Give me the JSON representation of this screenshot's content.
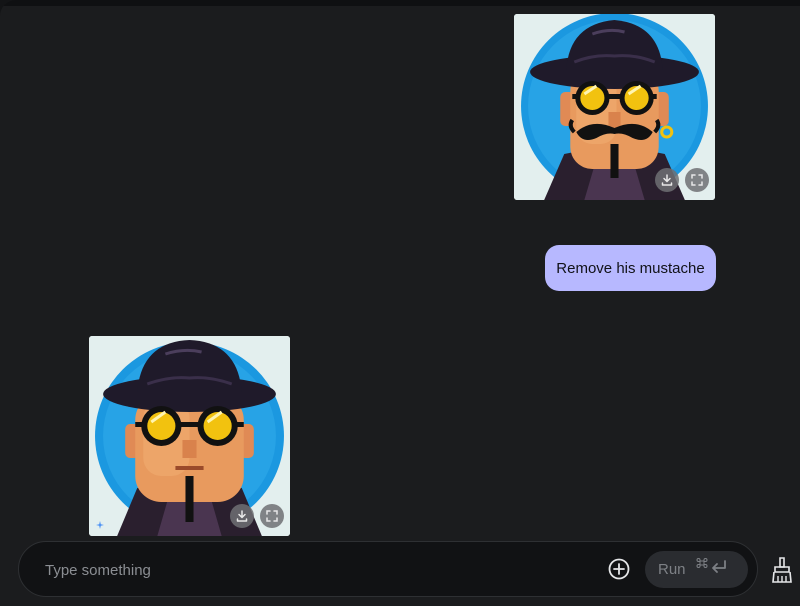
{
  "messages": [
    {
      "role": "model",
      "type": "image",
      "image_name": "pixel-art-man-with-mustache",
      "actions": [
        "download-icon",
        "fullscreen-icon"
      ]
    },
    {
      "role": "user",
      "type": "text",
      "text": "Remove his mustache"
    },
    {
      "role": "model",
      "type": "image",
      "image_name": "pixel-art-man-without-mustache",
      "actions": [
        "download-icon",
        "fullscreen-icon"
      ],
      "badge_icon": "sparkle-icon"
    }
  ],
  "composer": {
    "placeholder": "Type something",
    "value": "",
    "add_icon": "add-circle-icon",
    "run_label": "Run",
    "shortcut_icons": [
      "command-key-icon",
      "enter-key-icon"
    ]
  },
  "toolbar": {
    "clear_icon": "broom-icon"
  },
  "colors": {
    "background": "#1b1c1e",
    "user_bubble": "#b7b8ff",
    "portrait_circle": "#1b98e0",
    "hat": "#1f1a2a",
    "goggle_lens": "#f2c20f",
    "skin": "#e89a5e"
  }
}
